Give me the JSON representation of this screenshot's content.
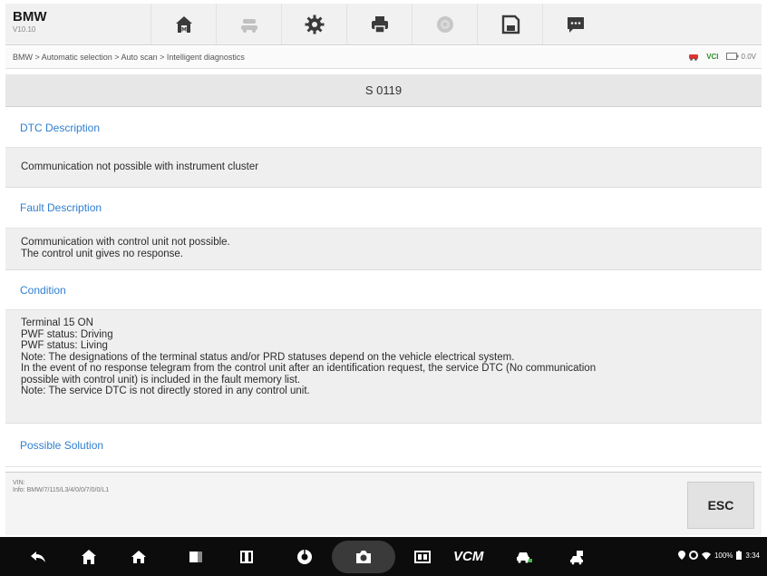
{
  "header": {
    "make": "BMW",
    "version": "V10.10"
  },
  "toolbar": {
    "items": [
      {
        "icon": "home-icon"
      },
      {
        "icon": "vehicle-swap-icon"
      },
      {
        "icon": "settings-icon"
      },
      {
        "icon": "print-icon"
      },
      {
        "icon": "help-icon"
      },
      {
        "icon": "save-icon"
      },
      {
        "icon": "feedback-icon"
      }
    ]
  },
  "breadcrumb": "BMW > Automatic selection > Auto scan > Intelligent diagnostics",
  "status": {
    "vci": "VCI",
    "battery": "0.0V"
  },
  "page_title": "S 0119",
  "sections": {
    "dtc_description": {
      "heading": "DTC Description",
      "lines": [
        "Communication not possible with instrument cluster"
      ]
    },
    "fault_description": {
      "heading": "Fault Description",
      "lines": [
        "Communication with control unit not possible.",
        "The control unit gives no response."
      ]
    },
    "condition": {
      "heading": "Condition",
      "lines": [
        "Terminal 15 ON",
        "PWF status: Driving",
        "PWF status: Living",
        "Note: The designations of the terminal status and/or PRD statuses depend on the vehicle electrical system.",
        "In the event of no response telegram from the control unit after an identification request, the service DTC (No communication",
        "possible with control unit) is included in the fault memory list.",
        "Note: The service DTC is not directly stored in any control unit."
      ]
    },
    "possible_solution": {
      "heading": "Possible Solution"
    }
  },
  "lower": {
    "vin_label": "VIN:",
    "info_label": "Info: BMW/7/115/L3/4/0/0/7/0/0/L1",
    "esc_label": "ESC"
  },
  "navbar": {
    "vcm_label": "VCM",
    "battery_percent": "100%",
    "time": "3:34"
  },
  "colors": {
    "accent_blue": "#2f7fd1",
    "vci_green": "#2c8f2c"
  }
}
